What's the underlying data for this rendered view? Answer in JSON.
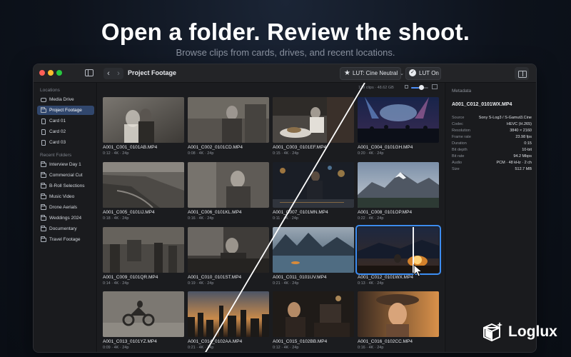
{
  "hero": {
    "title": "Open a folder. Review the shoot.",
    "subtitle": "Browse clips from cards, drives, and recent locations."
  },
  "toolbar": {
    "folder_title": "Project Footage",
    "lut_label": "LUT: Cine Neutral",
    "lut_toggle_label": "LUT On"
  },
  "sidebar": {
    "locations_label": "Locations",
    "locations": [
      {
        "label": "Media Drive",
        "icon": "drive-icon"
      },
      {
        "label": "Project Footage",
        "icon": "folder-icon",
        "selected": true
      },
      {
        "label": "Card 01",
        "icon": "card-icon"
      },
      {
        "label": "Card 02",
        "icon": "card-icon"
      },
      {
        "label": "Card 03",
        "icon": "card-icon"
      }
    ],
    "recent_label": "Recent Folders",
    "recent": [
      {
        "label": "Interview Day 1"
      },
      {
        "label": "Commercial Cut"
      },
      {
        "label": "B-Roll Selections"
      },
      {
        "label": "Music Video"
      },
      {
        "label": "Drone Aerials"
      },
      {
        "label": "Weddings 2024"
      },
      {
        "label": "Documentary"
      },
      {
        "label": "Travel Footage"
      }
    ]
  },
  "browser": {
    "info": "129 clips · 48.62 GB",
    "thumbnail_zoom": 0.45,
    "clips": [
      {
        "name": "A001_C001_0101AB.MP4",
        "meta": "0:12 · 4K · 24p"
      },
      {
        "name": "A001_C002_0101CD.MP4",
        "meta": "0:08 · 4K · 24p"
      },
      {
        "name": "A001_C003_0101EF.MP4",
        "meta": "0:15 · 4K · 24p"
      },
      {
        "name": "A001_C004_0101GH.MP4",
        "meta": "0:20 · 4K · 24p"
      },
      {
        "name": "A001_C005_0101IJ.MP4",
        "meta": "0:18 · 4K · 24p"
      },
      {
        "name": "A001_C006_0101KL.MP4",
        "meta": "0:16 · 4K · 24p"
      },
      {
        "name": "A001_C007_0101MN.MP4",
        "meta": "0:11 · 4K · 24p"
      },
      {
        "name": "A001_C008_0101OP.MP4",
        "meta": "0:22 · 4K · 24p"
      },
      {
        "name": "A001_C009_0101QR.MP4",
        "meta": "0:14 · 4K · 24p"
      },
      {
        "name": "A001_C010_0101ST.MP4",
        "meta": "0:19 · 4K · 24p"
      },
      {
        "name": "A001_C011_0101UV.MP4",
        "meta": "0:21 · 4K · 24p"
      },
      {
        "name": "A001_C012_0101WX.MP4",
        "meta": "0:13 · 4K · 24p",
        "selected": true
      },
      {
        "name": "A001_C013_0101YZ.MP4",
        "meta": "0:09 · 4K · 24p"
      },
      {
        "name": "A001_C014_0102AA.MP4",
        "meta": "0:21 · 4K · 24p"
      },
      {
        "name": "A001_C015_0102BB.MP4",
        "meta": "0:12 · 4K · 24p"
      },
      {
        "name": "A001_C016_0102CC.MP4",
        "meta": "0:16 · 4K · 24p"
      }
    ]
  },
  "inspector": {
    "heading": "Metadata",
    "filename": "A001_C012_0101WX.MP4",
    "rows": [
      {
        "key": "Source",
        "value": "Sony S-Log3 / S-Gamut3.Cine"
      },
      {
        "key": "Codec",
        "value": "HEVC (H.265)"
      },
      {
        "key": "Resolution",
        "value": "3840 × 2160"
      },
      {
        "key": "Frame rate",
        "value": "23.98 fps"
      },
      {
        "key": "Duration",
        "value": "0:15"
      },
      {
        "key": "Bit depth",
        "value": "10-bit"
      },
      {
        "key": "Bit rate",
        "value": "94.2 Mbps"
      },
      {
        "key": "Audio",
        "value": "PCM · 48 kHz · 2 ch"
      },
      {
        "key": "Size",
        "value": "512.7 MB"
      }
    ]
  },
  "brand": {
    "name": "Loglux"
  }
}
